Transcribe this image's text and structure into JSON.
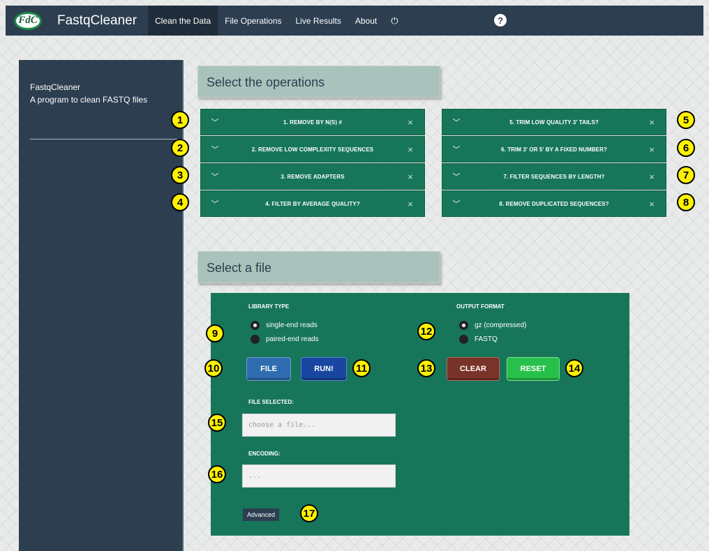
{
  "nav": {
    "logo": "FdC",
    "brand": "FastqCleaner",
    "items": [
      "Clean the Data",
      "File Operations",
      "Live Results",
      "About"
    ],
    "power_glyph": "⏻",
    "help_glyph": "?"
  },
  "sidebar": {
    "title": "FastqCleaner",
    "subtitle": "A program to clean FASTQ files"
  },
  "operations": {
    "header": "Select the operations",
    "left": [
      "1. REMOVE BY N(S) #",
      "2. REMOVE LOW COMPLEXITY SEQUENCES",
      "3. REMOVE ADAPTERS",
      "4. FILTER BY AVERAGE QUALITY?"
    ],
    "right": [
      "5. TRIM LOW QUALITY 3' TAILS?",
      "6. TRIM 3' OR 5' BY A FIXED NUMBER?",
      "7. FILTER SEQUENCES BY LENGTH?",
      "8. REMOVE DUPLICATED SEQUENCES?"
    ],
    "chevron_glyph": "﹀",
    "close_glyph": "×"
  },
  "file_section": {
    "header": "Select a file",
    "library_type_label": "LIBRARY TYPE",
    "library_options": [
      "single-end reads",
      "paired-end reads"
    ],
    "output_format_label": "OUTPUT FORMAT",
    "output_options": [
      "gz (compressed)",
      "FASTQ"
    ],
    "file_button": "FILE",
    "run_button": "RUN!",
    "clear_button": "CLEAR",
    "reset_button": "RESET",
    "file_selected_label": "FILE SELECTED:",
    "file_placeholder": "choose a file...",
    "encoding_label": "ENCODING:",
    "encoding_placeholder": "...",
    "advanced_button": "Advanced"
  },
  "badges": [
    "1",
    "2",
    "3",
    "4",
    "5",
    "6",
    "7",
    "8",
    "9",
    "10",
    "11",
    "12",
    "13",
    "14",
    "15",
    "16",
    "17"
  ],
  "colors": {
    "nav": "#2c3e50",
    "panel_green": "#17765a",
    "file_btn": "#2f6db0",
    "run_btn": "#1846a0",
    "clear_btn": "#7a3328",
    "reset_btn": "#27c04a",
    "badge": "#fff200"
  }
}
